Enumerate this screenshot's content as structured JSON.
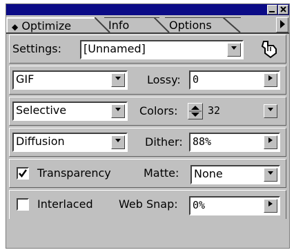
{
  "tabs": [
    {
      "label": "Optimize",
      "icon": "up-down-arrows-icon"
    },
    {
      "label": "Info"
    },
    {
      "label": "Options"
    }
  ],
  "settings": {
    "label": "Settings:",
    "value": "[Unnamed]"
  },
  "format": {
    "value": "GIF"
  },
  "lossy": {
    "label": "Lossy:",
    "value": "0"
  },
  "palette": {
    "value": "Selective"
  },
  "colors": {
    "label": "Colors:",
    "value": "32"
  },
  "dither_algorithm": {
    "value": "Diffusion"
  },
  "dither": {
    "label": "Dither:",
    "value": "88%"
  },
  "transparency": {
    "label": "Transparency",
    "checked": true
  },
  "matte": {
    "label": "Matte:",
    "value": "None"
  },
  "interlaced": {
    "label": "Interlaced",
    "checked": false
  },
  "web_snap": {
    "label": "Web Snap:",
    "value": "0%"
  },
  "colors_palette": {
    "titlebar": "#0b0b86",
    "panel": "#c0c0c0"
  }
}
